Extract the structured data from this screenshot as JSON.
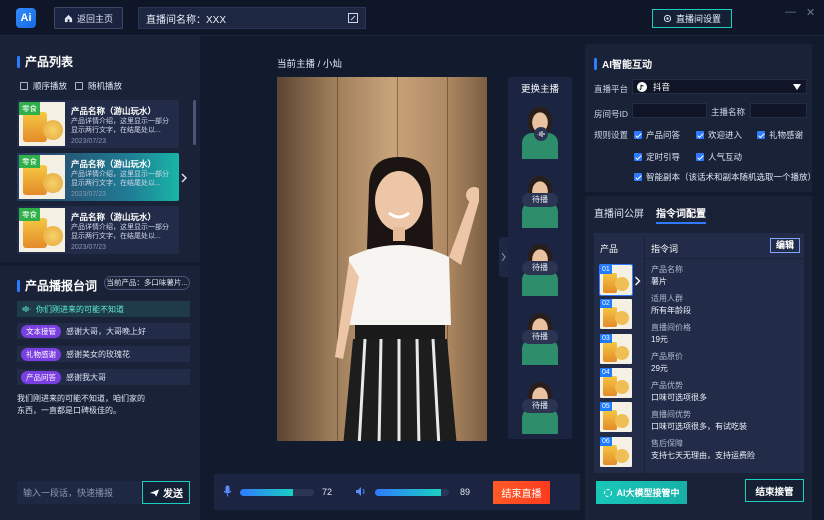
{
  "topbar": {
    "logo": "Ai",
    "home_label": "返回主页",
    "room_name": "直播间名称：XXX",
    "settings_label": "直播间设置",
    "minimize": "—",
    "close": "✕"
  },
  "product_list": {
    "title": "产品列表",
    "opt_sequential": "顺序播放",
    "opt_random": "随机播放",
    "items": [
      {
        "tag": "零食",
        "name": "产品名称（游山玩水）",
        "desc": "产品详情介绍，这里显示一部分显示两行文字，在结尾处以...",
        "date": "2023/07/23"
      },
      {
        "tag": "零食",
        "name": "产品名称（游山玩水）",
        "desc": "产品详情介绍，这里显示一部分显示两行文字，在结尾处以...",
        "date": "2023/07/23"
      },
      {
        "tag": "零食",
        "name": "产品名称（游山玩水）",
        "desc": "产品详情介绍，这里显示一部分显示两行文字，在结尾处以...",
        "date": "2023/07/23"
      }
    ]
  },
  "script_panel": {
    "title": "产品播报台词",
    "current_product": "当前产品：多口味薯片...",
    "listen_text": "你们刚进来的可能不知道",
    "items": [
      {
        "tag": "文本接管",
        "text": "感谢大哥，大哥晚上好"
      },
      {
        "tag": "礼物感谢",
        "text": "感谢美女的玫瑰花"
      },
      {
        "tag": "产品问答",
        "text": "感谢我大哥"
      }
    ],
    "body_text": "我们刚进来的可能不知道，咱们家的东西，一直都是口碑极佳的。",
    "input_placeholder": "输入一段话，快速播报",
    "send_label": "发送"
  },
  "center": {
    "current_host": "当前主播 / 小灿",
    "switch_host": "更换主播",
    "anchor_labels": [
      "",
      "待播",
      "待播",
      "待播",
      "待播"
    ],
    "mic_level": 72,
    "volume_level": 89,
    "end_live": "结束直播"
  },
  "ai_panel": {
    "title": "AI智能互动",
    "platform_label": "直播平台",
    "platform_value": "抖音",
    "room_id_label": "房间号ID",
    "host_name_label": "主播名称",
    "rules_label": "规则设置",
    "rules": [
      "产品问答",
      "欢迎进入",
      "礼物感谢",
      "定时引导",
      "人气互动",
      "智能副本（该话术和副本随机选取一个播放）"
    ]
  },
  "command_panel": {
    "tab_screen": "直播间公屏",
    "tab_commands": "指令词配置",
    "col_product": "产品",
    "col_command": "指令词",
    "edit": "编辑",
    "product_numbers": [
      "01",
      "02",
      "03",
      "04",
      "05",
      "06"
    ],
    "fields": [
      {
        "k": "产品名称",
        "v": "薯片"
      },
      {
        "k": "适用人群",
        "v": "所有年龄段"
      },
      {
        "k": "直播间价格",
        "v": "19元"
      },
      {
        "k": "产品原价",
        "v": "29元"
      },
      {
        "k": "产品优势",
        "v": "口味可选项很多"
      },
      {
        "k": "直播间优势",
        "v": "口味可选项很多，有试吃装"
      },
      {
        "k": "售后保障",
        "v": "支持七天无理由，支持运费险"
      }
    ],
    "ai_takeover": "AI大模型接管中",
    "end_takeover": "结束接管"
  },
  "colors": {
    "accent": "#2f7bff",
    "teal": "#19d0c0",
    "danger": "#ff4a22"
  }
}
